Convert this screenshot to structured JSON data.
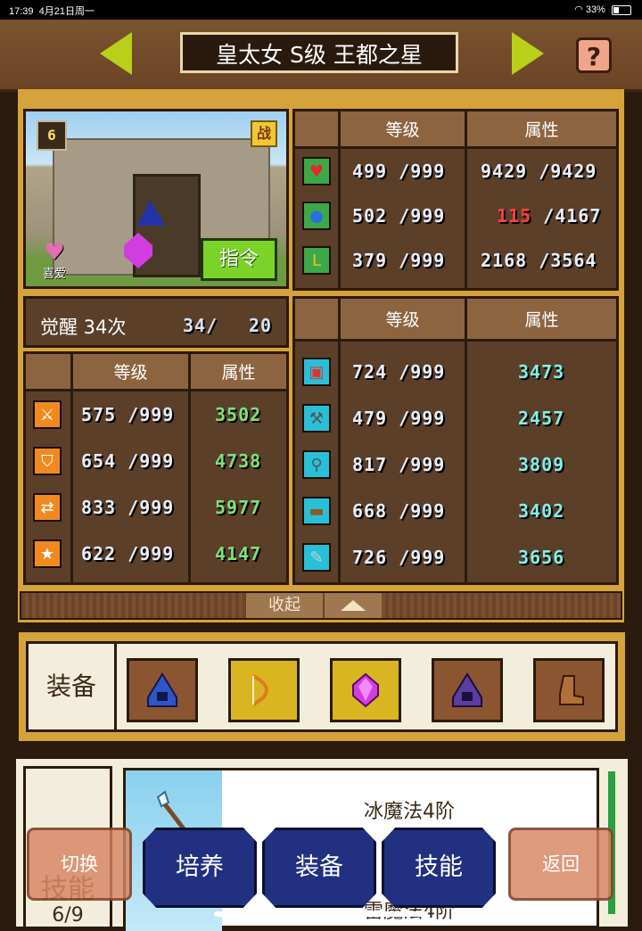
{
  "status_bar": {
    "time": "17:39",
    "date": "4月21日周一",
    "battery": "33%"
  },
  "header": {
    "title": "皇太女 S级 王都之星",
    "help_label": "?"
  },
  "portrait": {
    "level": "6",
    "battle_badge": "战",
    "favorite_label": "喜爱",
    "command_button": "指令"
  },
  "top_stats": {
    "col_level": "等级",
    "col_attr": "属性",
    "rows": [
      {
        "icon": "heart-icon",
        "level": "499 /999",
        "attr": "9429 /9429",
        "attr_highlight": ""
      },
      {
        "icon": "potion-icon",
        "level": "502 /999",
        "attr_highlight": "115",
        "attr": " /4167"
      },
      {
        "icon": "muscle-icon",
        "level": "379 /999",
        "attr": "2168 /3564",
        "attr_highlight": ""
      }
    ]
  },
  "awakening": {
    "label": "觉醒 34次",
    "value": "34/",
    "max": "20"
  },
  "left_stats": {
    "col_level": "等级",
    "col_attr": "属性",
    "rows": [
      {
        "icon": "sword-icon",
        "level": "575 /999",
        "attr": "3502"
      },
      {
        "icon": "shield-icon",
        "level": "654 /999",
        "attr": "4738"
      },
      {
        "icon": "arrows-icon",
        "level": "833 /999",
        "attr": "5977"
      },
      {
        "icon": "star-icon",
        "level": "622 /999",
        "attr": "4147"
      }
    ]
  },
  "right_stats": {
    "col_level": "等级",
    "col_attr": "属性",
    "rows": [
      {
        "icon": "scroll-icon",
        "level": "724 /999",
        "attr": "3473"
      },
      {
        "icon": "hammer-icon",
        "level": "479 /999",
        "attr": "2457"
      },
      {
        "icon": "shovel-icon",
        "level": "817 /999",
        "attr": "3809"
      },
      {
        "icon": "anvil-icon",
        "level": "668 /999",
        "attr": "3402"
      },
      {
        "icon": "tool-icon",
        "level": "726 /999",
        "attr": "3656"
      }
    ]
  },
  "collapse": {
    "label": "收起"
  },
  "equipment": {
    "label": "装备",
    "slots": [
      {
        "icon": "blue-hood-icon",
        "bg": "brown"
      },
      {
        "icon": "bow-icon",
        "bg": "gold"
      },
      {
        "icon": "magenta-gem-icon",
        "bg": "gold"
      },
      {
        "icon": "purple-hood-icon",
        "bg": "brown"
      },
      {
        "icon": "boot-icon",
        "bg": "brown"
      }
    ]
  },
  "skills": {
    "label": "技能",
    "count": "6/9",
    "items": [
      {
        "name": "冰魔法4阶"
      },
      {
        "name": "雷魔法4阶"
      }
    ]
  },
  "bottom_nav": {
    "switch": "切换",
    "train": "培养",
    "equip": "装备",
    "skill": "技能",
    "back": "返回"
  },
  "colors": {
    "number_white": "#e8eef8",
    "number_green": "#7de07a",
    "number_cyan": "#7ff0e8",
    "number_red": "#ff4040",
    "accent_green": "#b8d01a"
  }
}
